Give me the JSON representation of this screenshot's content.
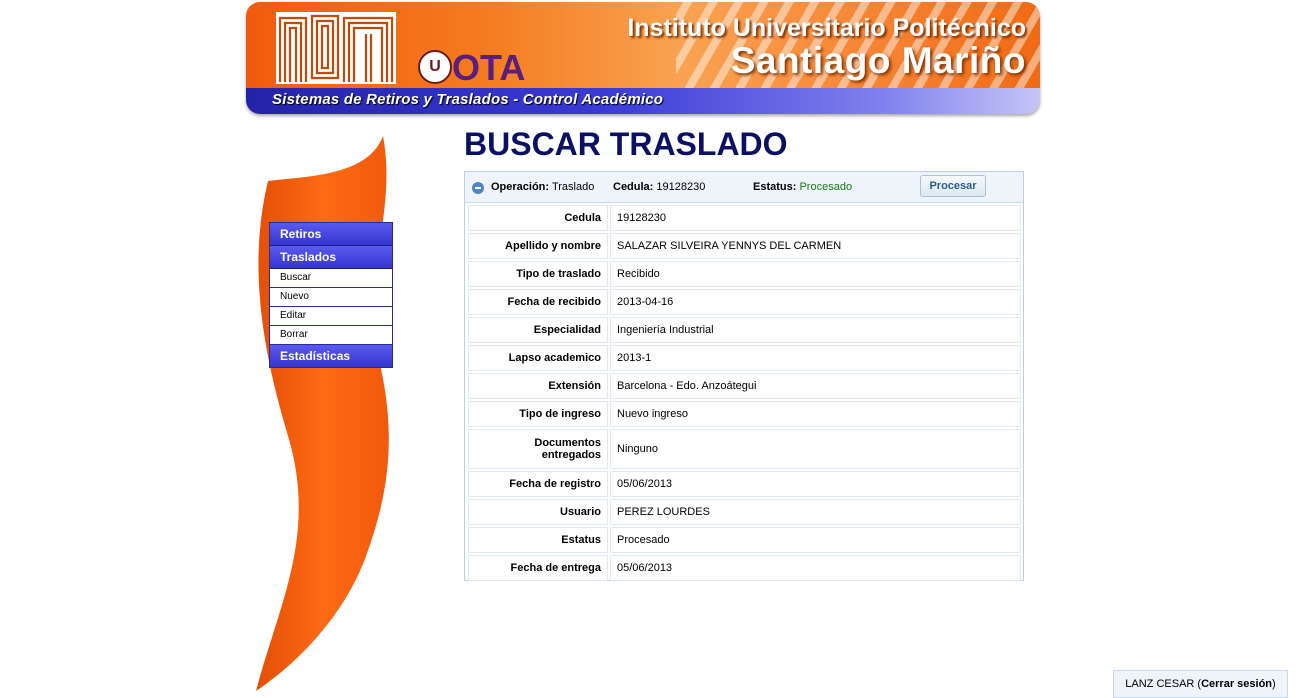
{
  "banner": {
    "title_line1": "Instituto Universitario Politécnico",
    "title_line2": "Santiago Mariño",
    "subtitle": "Sistemas de Retiros y Traslados - Control Académico",
    "logo_letters": "OTA"
  },
  "menu": {
    "retiros": "Retiros",
    "traslados": "Traslados",
    "sub_items": [
      "Buscar",
      "Nuevo",
      "Editar",
      "Borrar"
    ],
    "estadisticas": "Estadísticas"
  },
  "page_title": "BUSCAR TRASLADO",
  "panel": {
    "header": {
      "operacion_label": "Operación:",
      "operacion_value": "Traslado",
      "cedula_label": "Cedula:",
      "cedula_value": "19128230",
      "estatus_label": "Estatus:",
      "estatus_value": "Procesado",
      "button": "Procesar"
    },
    "rows": [
      {
        "label": "Cedula",
        "value": "19128230"
      },
      {
        "label": "Apellido y nombre",
        "value": "SALAZAR SILVEIRA YENNYS DEL CARMEN"
      },
      {
        "label": "Tipo de traslado",
        "value": "Recibido"
      },
      {
        "label": "Fecha de recibido",
        "value": "2013-04-16"
      },
      {
        "label": "Especialidad",
        "value": "Ingeniería Industrial"
      },
      {
        "label": "Lapso academico",
        "value": "2013-1"
      },
      {
        "label": "Extensión",
        "value": "Barcelona - Edo. Anzoátegui"
      },
      {
        "label": "Tipo de ingreso",
        "value": "Nuevo ingreso"
      },
      {
        "label": "Documentos entregados",
        "value": "Ninguno"
      },
      {
        "label": "Fecha de registro",
        "value": "05/06/2013"
      },
      {
        "label": "Usuario",
        "value": "PEREZ LOURDES"
      },
      {
        "label": "Estatus",
        "value": "Procesado"
      },
      {
        "label": "Fecha de entrega",
        "value": "05/06/2013"
      }
    ]
  },
  "session": {
    "user": "LANZ CESAR",
    "logout": "Cerrar sesión"
  }
}
